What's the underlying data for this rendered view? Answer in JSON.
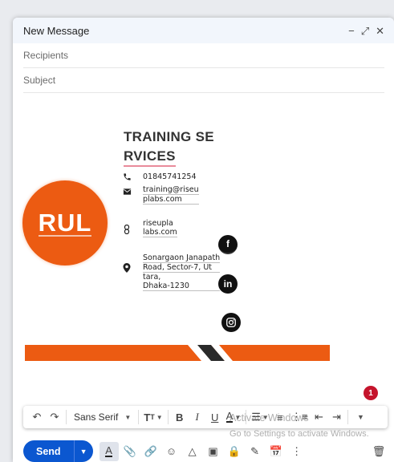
{
  "window": {
    "title": "New Message",
    "controls": [
      "minimize-icon",
      "expand-icon",
      "close-icon"
    ]
  },
  "recipients": {
    "placeholder": "Recipients"
  },
  "subject": {
    "placeholder": "Subject"
  },
  "signature": {
    "title_line1": "TRAINING SE",
    "title_line2": "RVICES",
    "logo_text": "RUL",
    "phone": "01845741254",
    "email_line1": "training@riseu",
    "email_line2": "plabs.com",
    "web_line1": "riseupla",
    "web_line2": "labs.com",
    "address_line1": "Sonargaon Janapath",
    "address_line2": "Road, Sector-7, Ut",
    "address_line3": "tara,",
    "address_line4": "Dhaka-1230",
    "social": {
      "facebook": "f",
      "linkedin": "in"
    },
    "colors": {
      "brand": "#ec5b12",
      "dark": "#222222"
    }
  },
  "notification_badge": "1",
  "format_toolbar": {
    "font": "Sans Serif",
    "items": [
      "undo-icon",
      "redo-icon",
      "font-select",
      "text-size-icon",
      "bold-icon",
      "italic-icon",
      "underline-icon",
      "text-color-icon",
      "align-icon",
      "numbered-list-icon",
      "bulleted-list-icon",
      "indent-less-icon",
      "indent-more-icon",
      "more-formatting-icon"
    ],
    "bold": "B",
    "italic": "I",
    "underline": "U"
  },
  "watermark": {
    "line1": "Activate Windows",
    "line2": "Go to Settings to activate Windows."
  },
  "bottom_toolbar": {
    "send_label": "Send",
    "tools": [
      "formatting-icon",
      "attach-icon",
      "link-icon",
      "emoji-icon",
      "drive-icon",
      "photo-icon",
      "confidential-icon",
      "signature-icon",
      "schedule-icon",
      "more-options-icon"
    ],
    "accent": "#0b57d0"
  }
}
